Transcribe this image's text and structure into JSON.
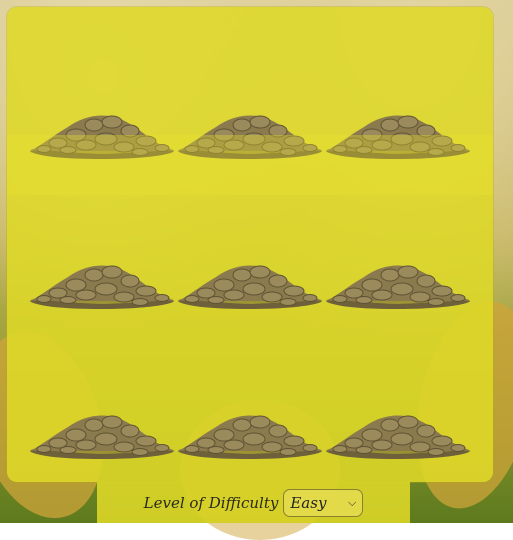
{
  "game": {
    "grid": {
      "rows": 3,
      "cols": 3,
      "hole_icon": "dirt-mound-icon"
    },
    "colors": {
      "board": "#ded828",
      "dirt": "#8a7a4e",
      "dirt_dark": "#6e603a"
    }
  },
  "footer": {
    "difficulty_label": "Level of Difficulty",
    "difficulty_selected": "Easy"
  }
}
